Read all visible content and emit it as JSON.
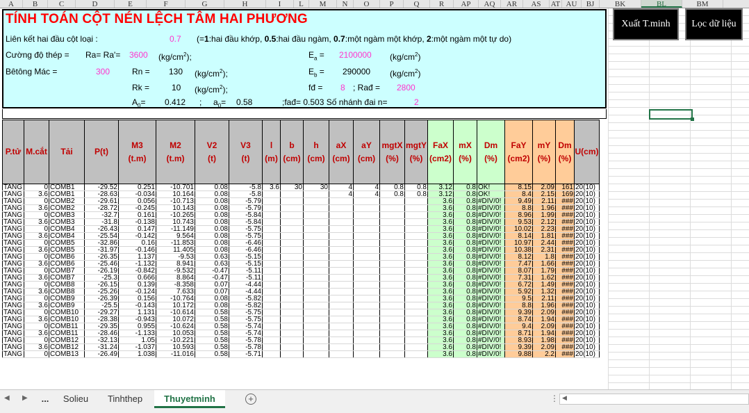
{
  "columns": [
    "A",
    "B",
    "C",
    "D",
    "E",
    "F",
    "G",
    "H",
    "I",
    "L",
    "M",
    "N",
    "O",
    "P",
    "Q",
    "R",
    "AP",
    "AQ",
    "AR",
    "AS",
    "AT",
    "AU",
    "BJ",
    "BK",
    "BL",
    "BM"
  ],
  "selected_column": "BL",
  "panel": {
    "title": "TÍNH TOÁN CỘT NÉN LỆCH TÂM HAI PHƯƠNG",
    "line1_label": "Liên kết hai đầu cột loại :",
    "line1_value": "0.7",
    "line1_note_a": "(=",
    "line1_note_b": "1",
    "line1_note_c": ":hai đầu khớp, ",
    "line1_note_d": "0.5",
    "line1_note_e": ":hai đầu ngàm, ",
    "line1_note_f": "0.7",
    "line1_note_g": ":một ngàm một khớp, ",
    "line1_note_h": "2",
    "line1_note_i": ":một ngàm một tự do)",
    "steel_label": "Cường độ thép =",
    "ra_label": "Ra= Ra'=",
    "ra_value": "3600",
    "ra_unit_a": "(kg/cm",
    "ra_unit_b": "2",
    "ra_unit_c": ");",
    "ea_label_a": "E",
    "ea_label_b": "a",
    "ea_label_c": " =",
    "ea_value": "2100000",
    "ea_unit_a": "(kg/cm",
    "ea_unit_b": "2",
    "ea_unit_c": ")",
    "concrete_label": "Bêtông Mác =",
    "concrete_value": "300",
    "rn_label": "Rn =",
    "rn_value": "130",
    "rn_unit_a": "(kg/cm",
    "rn_unit_b": "2",
    "rn_unit_c": ");",
    "eb_label_a": "E",
    "eb_label_b": "b",
    "eb_label_c": " =",
    "eb_value": "290000",
    "eb_unit_a": "(kg/cm",
    "eb_unit_b": "2",
    "eb_unit_c": ")",
    "rk_label": "Rk =",
    "rk_value": "10",
    "rk_unit_a": "(kg/cm",
    "rk_unit_b": "2",
    "rk_unit_c": ");",
    "fd_label": "fđ =",
    "fd_value": "8",
    "rad_label": "; Rađ =",
    "rad_value": "2800",
    "a0_label_a": "A",
    "a0_label_b": "0",
    "a0_label_c": "=",
    "a0_value": "0.412",
    "sep": ";",
    "a0s_label_a": "a",
    "a0s_label_b": "0",
    "a0s_label_c": "=",
    "a0s_value": "0.58",
    "fad_text": ";fađ= 0.503  Số nhánh đai n=",
    "n_value": "2"
  },
  "buttons": {
    "xuat": "Xuất T.minh",
    "loc": "Lọc dữ liệu"
  },
  "table": {
    "headers": [
      {
        "main": "P.tử",
        "sub": ""
      },
      {
        "main": "M.cắt",
        "sub": ""
      },
      {
        "main": "Tải",
        "sub": ""
      },
      {
        "main": "P(t)",
        "sub": ""
      },
      {
        "main": "M3",
        "sub": "(t.m)"
      },
      {
        "main": "M2",
        "sub": "(t.m)"
      },
      {
        "main": "V2",
        "sub": "(t)"
      },
      {
        "main": "V3",
        "sub": "(t)"
      },
      {
        "main": "l",
        "sub": "(m)"
      },
      {
        "main": "b",
        "sub": "(cm)"
      },
      {
        "main": "h",
        "sub": "(cm)"
      },
      {
        "main": "aX",
        "sub": "(cm)"
      },
      {
        "main": "aY",
        "sub": "(cm)"
      },
      {
        "main": "mgtX",
        "sub": "(%)"
      },
      {
        "main": "mgtY",
        "sub": "(%)"
      },
      {
        "main": "FaX",
        "sub": "(cm2)"
      },
      {
        "main": "mX",
        "sub": "(%)"
      },
      {
        "main": "Dm",
        "sub": "(%)"
      },
      {
        "main": "FaY",
        "sub": "(cm2)"
      },
      {
        "main": "mY",
        "sub": "(%)"
      },
      {
        "main": "Dm",
        "sub": "(%)"
      },
      {
        "main": "U(cm)",
        "sub": ""
      }
    ],
    "rows": [
      [
        "TANG",
        "0",
        "COMB1",
        "-29.52",
        "0.251",
        "-10.701",
        "0.08",
        "-5.8",
        "3.6",
        "30",
        "30",
        "4",
        "4",
        "0.8",
        "0.8",
        "3.12",
        "0.8",
        "OK!",
        "8.15",
        "2.09",
        "161",
        "20(10)"
      ],
      [
        "TANG",
        "3.6",
        "COMB1",
        "-28.63",
        "-0.034",
        "10.164",
        "0.08",
        "-5.8",
        "",
        "",
        "",
        "4",
        "4",
        "0.8",
        "0.8",
        "3.12",
        "0.8",
        "OK!",
        "8.4",
        "2.15",
        "169",
        "20(10)"
      ],
      [
        "TANG",
        "0",
        "COMB2",
        "-29.61",
        "0.056",
        "-10.713",
        "0.08",
        "-5.79",
        "",
        "",
        "",
        "",
        "",
        "",
        "",
        "3.6",
        "0.8",
        "#DIV/0!",
        "9.49",
        "2.11",
        "###",
        "20(10)"
      ],
      [
        "TANG",
        "3.6",
        "COMB2",
        "-28.72",
        "-0.245",
        "10.143",
        "0.08",
        "-5.79",
        "",
        "",
        "",
        "",
        "",
        "",
        "",
        "3.6",
        "0.8",
        "#DIV/0!",
        "8.8",
        "1.96",
        "###",
        "20(10)"
      ],
      [
        "TANG",
        "0",
        "COMB3",
        "-32.7",
        "0.161",
        "-10.265",
        "0.08",
        "-5.84",
        "",
        "",
        "",
        "",
        "",
        "",
        "",
        "3.6",
        "0.8",
        "#DIV/0!",
        "8.96",
        "1.99",
        "###",
        "20(10)"
      ],
      [
        "TANG",
        "3.6",
        "COMB3",
        "-31.8",
        "-0.138",
        "10.743",
        "0.08",
        "-5.84",
        "",
        "",
        "",
        "",
        "",
        "",
        "",
        "3.6",
        "0.8",
        "#DIV/0!",
        "9.53",
        "2.12",
        "###",
        "20(10)"
      ],
      [
        "TANG",
        "0",
        "COMB4",
        "-26.43",
        "0.147",
        "-11.149",
        "0.08",
        "-5.75",
        "",
        "",
        "",
        "",
        "",
        "",
        "",
        "3.6",
        "0.8",
        "#DIV/0!",
        "10.02",
        "2.23",
        "###",
        "20(10)"
      ],
      [
        "TANG",
        "3.6",
        "COMB4",
        "-25.54",
        "-0.142",
        "9.564",
        "0.08",
        "-5.75",
        "",
        "",
        "",
        "",
        "",
        "",
        "",
        "3.6",
        "0.8",
        "#DIV/0!",
        "8.14",
        "1.81",
        "###",
        "20(10)"
      ],
      [
        "TANG",
        "0",
        "COMB5",
        "-32.86",
        "0.16",
        "-11.853",
        "0.08",
        "-6.46",
        "",
        "",
        "",
        "",
        "",
        "",
        "",
        "3.6",
        "0.8",
        "#DIV/0!",
        "10.97",
        "2.44",
        "###",
        "20(10)"
      ],
      [
        "TANG",
        "3.6",
        "COMB5",
        "-31.97",
        "-0.146",
        "11.405",
        "0.08",
        "-6.46",
        "",
        "",
        "",
        "",
        "",
        "",
        "",
        "3.6",
        "0.8",
        "#DIV/0!",
        "10.38",
        "2.31",
        "###",
        "20(10)"
      ],
      [
        "TANG",
        "0",
        "COMB6",
        "-26.35",
        "1.137",
        "-9.53",
        "0.63",
        "-5.15",
        "",
        "",
        "",
        "",
        "",
        "",
        "",
        "3.6",
        "0.8",
        "#DIV/0!",
        "8.12",
        "1.8",
        "###",
        "20(10)"
      ],
      [
        "TANG",
        "3.6",
        "COMB6",
        "-25.46",
        "-1.132",
        "8.941",
        "0.63",
        "-5.15",
        "",
        "",
        "",
        "",
        "",
        "",
        "",
        "3.6",
        "0.8",
        "#DIV/0!",
        "7.47",
        "1.66",
        "###",
        "20(10)"
      ],
      [
        "TANG",
        "0",
        "COMB7",
        "-26.19",
        "-0.842",
        "-9.532",
        "-0.47",
        "-5.11",
        "",
        "",
        "",
        "",
        "",
        "",
        "",
        "3.6",
        "0.8",
        "#DIV/0!",
        "8.07",
        "1.79",
        "###",
        "20(10)"
      ],
      [
        "TANG",
        "3.6",
        "COMB7",
        "-25.3",
        "0.666",
        "8.864",
        "-0.47",
        "-5.11",
        "",
        "",
        "",
        "",
        "",
        "",
        "",
        "3.6",
        "0.8",
        "#DIV/0!",
        "7.31",
        "1.62",
        "###",
        "20(10)"
      ],
      [
        "TANG",
        "0",
        "COMB8",
        "-26.15",
        "0.139",
        "-8.358",
        "0.07",
        "-4.44",
        "",
        "",
        "",
        "",
        "",
        "",
        "",
        "3.6",
        "0.8",
        "#DIV/0!",
        "6.72",
        "1.49",
        "###",
        "20(10)"
      ],
      [
        "TANG",
        "3.6",
        "COMB8",
        "-25.26",
        "-0.124",
        "7.633",
        "0.07",
        "-4.44",
        "",
        "",
        "",
        "",
        "",
        "",
        "",
        "3.6",
        "0.8",
        "#DIV/0!",
        "5.92",
        "1.32",
        "###",
        "20(10)"
      ],
      [
        "TANG",
        "0",
        "COMB9",
        "-26.39",
        "0.156",
        "-10.764",
        "0.08",
        "-5.82",
        "",
        "",
        "",
        "",
        "",
        "",
        "",
        "3.6",
        "0.8",
        "#DIV/0!",
        "9.5",
        "2.11",
        "###",
        "20(10)"
      ],
      [
        "TANG",
        "3.6",
        "COMB9",
        "-25.5",
        "-0.143",
        "10.172",
        "0.08",
        "-5.82",
        "",
        "",
        "",
        "",
        "",
        "",
        "",
        "3.6",
        "0.8",
        "#DIV/0!",
        "8.8",
        "1.96",
        "###",
        "20(10)"
      ],
      [
        "TANG",
        "0",
        "COMB10",
        "-29.27",
        "1.131",
        "-10.614",
        "0.58",
        "-5.75",
        "",
        "",
        "",
        "",
        "",
        "",
        "",
        "3.6",
        "0.8",
        "#DIV/0!",
        "9.39",
        "2.09",
        "###",
        "20(10)"
      ],
      [
        "TANG",
        "3.6",
        "COMB10",
        "-28.38",
        "-0.943",
        "10.072",
        "0.58",
        "-5.75",
        "",
        "",
        "",
        "",
        "",
        "",
        "",
        "3.6",
        "0.8",
        "#DIV/0!",
        "8.74",
        "1.94",
        "###",
        "20(10)"
      ],
      [
        "TANG",
        "0",
        "COMB11",
        "-29.35",
        "0.955",
        "-10.624",
        "0.58",
        "-5.74",
        "",
        "",
        "",
        "",
        "",
        "",
        "",
        "3.6",
        "0.8",
        "#DIV/0!",
        "9.4",
        "2.09",
        "###",
        "20(10)"
      ],
      [
        "TANG",
        "3.6",
        "COMB11",
        "-28.46",
        "-1.133",
        "10.053",
        "0.58",
        "-5.74",
        "",
        "",
        "",
        "",
        "",
        "",
        "",
        "3.6",
        "0.8",
        "#DIV/0!",
        "8.71",
        "1.94",
        "###",
        "20(10)"
      ],
      [
        "TANG",
        "0",
        "COMB12",
        "-32.13",
        "1.05",
        "-10.221",
        "0.58",
        "-5.78",
        "",
        "",
        "",
        "",
        "",
        "",
        "",
        "3.6",
        "0.8",
        "#DIV/0!",
        "8.93",
        "1.98",
        "###",
        "20(10)"
      ],
      [
        "TANG",
        "3.6",
        "COMB12",
        "-31.24",
        "-1.037",
        "10.593",
        "0.58",
        "-5.78",
        "",
        "",
        "",
        "",
        "",
        "",
        "",
        "3.6",
        "0.8",
        "#DIV/0!",
        "9.39",
        "2.09",
        "###",
        "20(10)"
      ],
      [
        "TANG",
        "0",
        "COMB13",
        "-26.49",
        "1.038",
        "-11.016",
        "0.58",
        "-5.71",
        "",
        "",
        "",
        "",
        "",
        "",
        "",
        "3.6",
        "0.8",
        "#DIV/0!",
        "9.88",
        "2.2",
        "###",
        "20(10)"
      ]
    ]
  },
  "tabs": {
    "ellipsis": "...",
    "items": [
      "Solieu",
      "Tinhthep",
      "Thuyetminh"
    ],
    "active": "Thuyetminh"
  }
}
